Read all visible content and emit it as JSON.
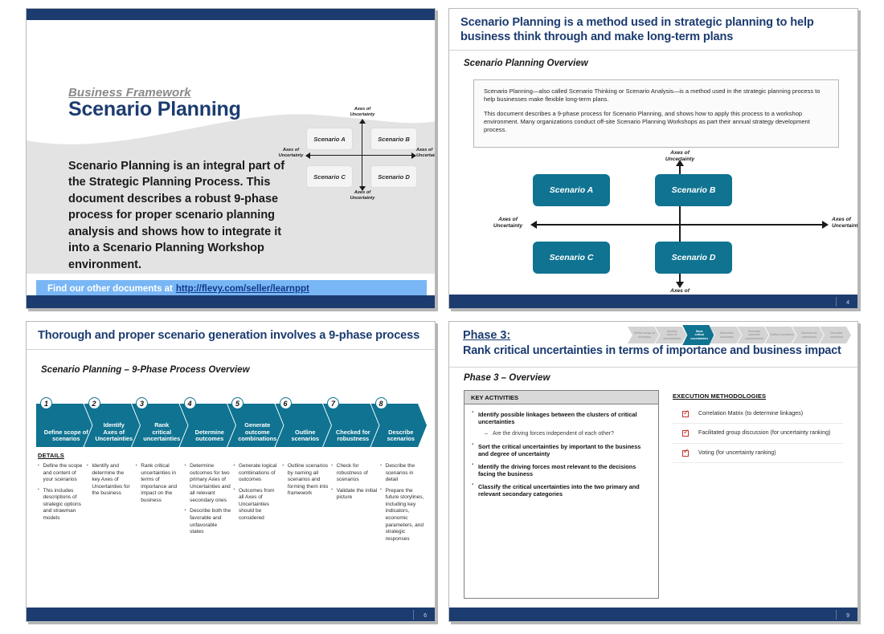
{
  "deck": {
    "accent_navy": "#1c3c70",
    "accent_teal": "#0f7391",
    "band_blue": "#79b6f5",
    "check_red": "#c4342a"
  },
  "title_slide": {
    "eyebrow": "Business Framework",
    "title": "Scenario Planning",
    "body": "Scenario Planning is an integral part of the Strategic Planning Process. This document describes a robust 9-phase process for proper scenario planning analysis and shows how to integrate it into a Scenario Planning Workshop environment.",
    "band_text": "Find our other documents at",
    "band_link": "http://flevy.com/seller/learnppt",
    "quadrant": {
      "axis_top": "Axes of\nUncertainty",
      "axis_bottom": "Axes of\nUncertainty",
      "axis_left": "Axes of\nUncertainty",
      "axis_right": "Axes of\nUncertainty",
      "boxes": [
        "Scenario A",
        "Scenario B",
        "Scenario C",
        "Scenario D"
      ]
    }
  },
  "overview_slide": {
    "heading": "Scenario Planning is a method used in strategic planning to help business think through and make long-term plans",
    "subheading": "Scenario Planning Overview",
    "paragraphs": [
      "Scenario Planning—also called Scenario Thinking or Scenario Analysis—is a method used in the strategic planning process to help businesses make flexible long-term plans.",
      "This document describes a 9-phase process for Scenario Planning, and shows how to apply this process to a workshop environment.  Many organizations conduct off-site Scenario Planning Workshops as part their annual strategy development process."
    ],
    "quadrant": {
      "axis_top": "Axes of\nUncertainty",
      "axis_bottom": "Axes of\nUncertainty",
      "axis_left": "Axes of\nUncertainty",
      "axis_right": "Axes of\nUncertainty",
      "boxes": [
        "Scenario A",
        "Scenario B",
        "Scenario C",
        "Scenario D"
      ]
    },
    "page_number": "4"
  },
  "process_slide": {
    "heading": "Thorough and proper scenario generation involves a 9-phase process",
    "subheading": "Scenario Planning – 9-Phase Process Overview",
    "details_label": "DETAILS",
    "page_number": "6",
    "phases": [
      {
        "num": "1",
        "label": "Define scope of\nscenarios",
        "details": [
          "Define the scope and content of your scenarios",
          "This includes descriptions of strategic options and strawman models"
        ]
      },
      {
        "num": "2",
        "label": "Identify\nAxes of\nUncertainties",
        "details": [
          "Identify and determine the key Axes of Uncertainties for the business"
        ]
      },
      {
        "num": "3",
        "label": "Rank\ncritical\nuncertainties",
        "details": [
          "Rank critical uncertainties in terms of importance and impact on the business"
        ]
      },
      {
        "num": "4",
        "label": "Determine\noutcomes",
        "details": [
          "Determine outcomes for two primary Axes of Uncertainties and all relevant secondary ones",
          "Describe both the favorable and unfavorable states"
        ]
      },
      {
        "num": "5",
        "label": "Generate\noutcome\ncombinations",
        "details": [
          "Generate logical combinations of outcomes",
          "Outcomes from all Axes of Uncertainties should be considered"
        ]
      },
      {
        "num": "6",
        "label": "Outline\nscenarios",
        "details": [
          "Outline scenarios by naming all scenarios and forming them into framework"
        ]
      },
      {
        "num": "7",
        "label": "Checked for\nrobustness",
        "details": [
          "Check for robustness of scenarios",
          "Validate the initial picture"
        ]
      },
      {
        "num": "8",
        "label": "Describe\nscenarios",
        "details": [
          "Describe the scenarios in detail",
          "Prepare the future storylines, including key indicators, economic parameters, and strategic responses"
        ]
      }
    ]
  },
  "phase3_slide": {
    "phase_label": "Phase 3:",
    "heading": "Rank critical uncertainties in terms of importance and business impact",
    "subheading": "Phase 3 – Overview",
    "page_number": "9",
    "mini_chevrons": [
      {
        "label": "Define scope of\nscenarios",
        "active": false
      },
      {
        "label": "Identify\nAxes of\nuncertainties",
        "active": false
      },
      {
        "label": "Rank\ncritical\nuncertainties",
        "active": true
      },
      {
        "label": "Determine\noutcomes",
        "active": false
      },
      {
        "label": "Generate\noutcome\ncombinations",
        "active": false
      },
      {
        "label": "Outline scenarios",
        "active": false
      },
      {
        "label": "Checked for\nrobustness",
        "active": false
      },
      {
        "label": "Describe\nscenarios",
        "active": false
      }
    ],
    "key_activities": {
      "header": "KEY ACTIVITIES",
      "items": [
        {
          "text": "Identify possible linkages between the clusters of critical uncertainties",
          "sub": "Are the driving forces independent of each other?"
        },
        {
          "text": "Sort the critical uncertainties by important to the business and degree of uncertainty",
          "sub": null
        },
        {
          "text": "Identify the driving forces most relevant to the decisions facing the business",
          "sub": null
        },
        {
          "text": "Classify the critical uncertainties into the two primary and relevant secondary categories",
          "sub": null
        }
      ]
    },
    "execution_methodologies": {
      "header": "EXECUTION METHODOLOGIES",
      "items": [
        "Correlation Matrix (to determine linkages)",
        "Facilitated group discussion (for uncertainty ranking)",
        "Voting (for uncertainty ranking)"
      ]
    }
  }
}
